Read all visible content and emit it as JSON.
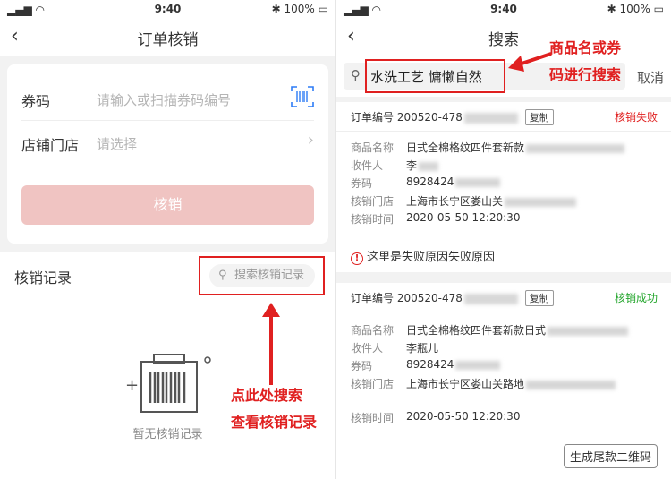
{
  "left": {
    "status": {
      "time": "9:40",
      "battery": "100%"
    },
    "nav": {
      "title": "订单核销"
    },
    "form": {
      "coupon_label": "券码",
      "coupon_placeholder": "请输入或扫描券码编号",
      "store_label": "店铺门店",
      "store_placeholder": "请选择",
      "verify_button": "核销"
    },
    "records": {
      "label": "核销记录",
      "search_placeholder": "搜索核销记录",
      "empty_text": "暂无核销记录"
    },
    "annotation": {
      "line1": "点此处搜索",
      "line2": "查看核销记录"
    }
  },
  "right": {
    "status": {
      "time": "9:40",
      "battery": "100%"
    },
    "nav": {
      "title": "搜索"
    },
    "search": {
      "value": "水洗工艺 慵懒自然",
      "cancel": "取消"
    },
    "annotation": {
      "line1": "商品名或券",
      "line2": "码进行搜索"
    },
    "labels": {
      "order_no": "订单编号",
      "copy": "复制",
      "product": "商品名称",
      "recipient": "收件人",
      "coupon": "券码",
      "store": "核销门店",
      "time": "核销时间"
    },
    "orders": [
      {
        "order_no": "200520-478",
        "status": "核销失败",
        "product": "日式全棉格纹四件套新款",
        "recipient": "李",
        "coupon": "8928424",
        "store": "上海市长宁区娄山关",
        "time": "2020-05-50 12:20:30",
        "fail_reason": "这里是失败原因失败原因"
      },
      {
        "order_no": "200520-478",
        "status": "核销成功",
        "product": "日式全棉格纹四件套新款日式",
        "recipient": "李瓶儿",
        "coupon": "8928424",
        "store": "上海市长宁区娄山关路地",
        "time": "2020-05-50 12:20:30",
        "qr_button": "生成尾款二维码"
      }
    ]
  },
  "colors": {
    "accent_red": "#e02020",
    "success_green": "#22a52b",
    "button_disabled": "#f0c4c2"
  }
}
